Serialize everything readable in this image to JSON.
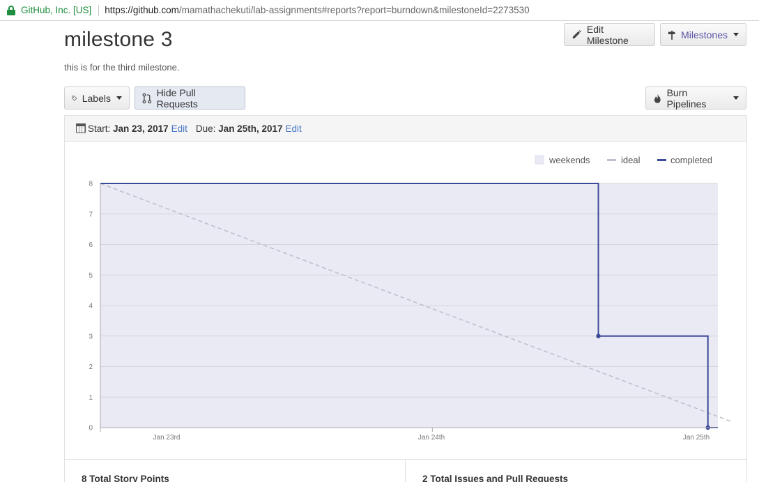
{
  "browser": {
    "site_identity": "GitHub, Inc. [US]",
    "url_host": "https://github.com",
    "url_path": "/mamathachekuti/lab-assignments#reports?report=burndown&milestoneId=2273530"
  },
  "milestone": {
    "title": "milestone 3",
    "description": "this is for the third milestone."
  },
  "toolbar": {
    "edit_milestone": "Edit Milestone",
    "milestones": "Milestones",
    "labels": "Labels",
    "hide_pull_requests": "Hide Pull Requests",
    "burn_pipelines": "Burn Pipelines"
  },
  "dates": {
    "start_label": "Start:",
    "start_value": "Jan 23, 2017",
    "start_edit": "Edit",
    "due_label": "Due:",
    "due_value": "Jan 25th, 2017",
    "due_edit": "Edit"
  },
  "chart_data": {
    "type": "line",
    "legend": [
      "weekends",
      "ideal",
      "completed"
    ],
    "x_ticks": [
      "Jan 23rd",
      "Jan 24th",
      "Jan 25th"
    ],
    "ylim": [
      0,
      8
    ],
    "y_ticks": [
      0,
      1,
      2,
      3,
      4,
      5,
      6,
      7,
      8
    ],
    "series": [
      {
        "name": "ideal",
        "color": "#c0c0cc",
        "style": "dashed",
        "points": [
          [
            0,
            8
          ],
          [
            1.9,
            0.2
          ]
        ]
      },
      {
        "name": "completed",
        "color": "#3d4a98",
        "style": "step",
        "points": [
          [
            0,
            8
          ],
          [
            1.5,
            8
          ],
          [
            1.5,
            3
          ],
          [
            1.83,
            3
          ],
          [
            1.83,
            0
          ],
          [
            1.86,
            0
          ]
        ]
      }
    ],
    "x_domain": [
      0,
      1.86
    ],
    "colors": {
      "weekends": "#eaeaf5",
      "ideal": "#c0c0cc",
      "completed": "#3d4a98"
    }
  },
  "stats": {
    "story_points": "8 Total Story Points",
    "issues": "2 Total Issues and Pull Requests"
  }
}
